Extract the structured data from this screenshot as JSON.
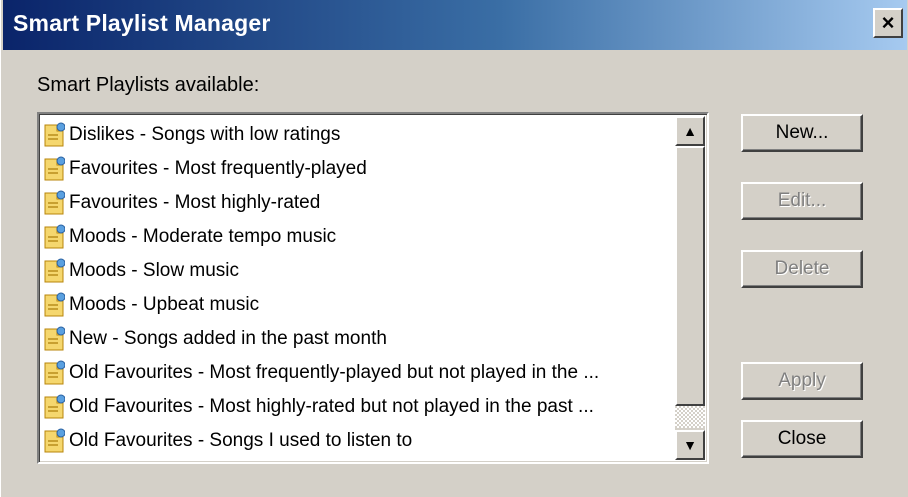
{
  "window": {
    "title": "Smart Playlist Manager",
    "close_label": "×"
  },
  "list_label": "Smart Playlists available:",
  "playlists": [
    "Dislikes - Songs with low ratings",
    "Favourites - Most frequently-played",
    "Favourites - Most highly-rated",
    "Moods - Moderate tempo music",
    "Moods - Slow music",
    "Moods - Upbeat music",
    "New - Songs added in the past month",
    "Old Favourites - Most frequently-played but not played in the ...",
    "Old Favourites - Most highly-rated but not played in the past ...",
    "Old Favourites - Songs I used to listen to"
  ],
  "buttons": {
    "new": "New...",
    "edit": "Edit...",
    "delete": "Delete",
    "apply": "Apply",
    "close": "Close"
  },
  "scroll_glyphs": {
    "up": "▲",
    "down": "▼"
  },
  "icons": {
    "item": "playlist-icon"
  },
  "colors": {
    "title_start": "#0a246a",
    "title_end": "#a6caf0",
    "face": "#d4d0c8",
    "icon_yellow": "#f5d76e"
  }
}
